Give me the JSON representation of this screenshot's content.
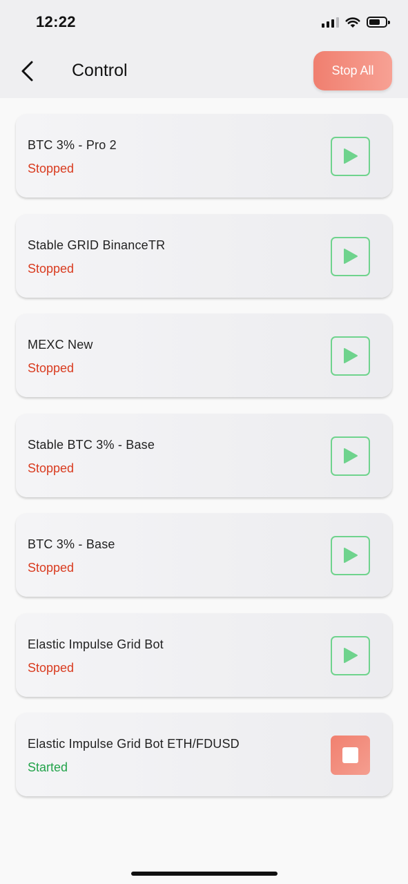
{
  "status_bar": {
    "time": "12:22",
    "icons": [
      "cellular-signal-icon",
      "wifi-icon",
      "battery-icon"
    ]
  },
  "header": {
    "title": "Control",
    "back_icon": "chevron-left-icon",
    "stop_all_label": "Stop All"
  },
  "colors": {
    "stopped": "#d93b1f",
    "started": "#22a34a",
    "start_button": "#6fd38d",
    "stop_button": "#f1806f"
  },
  "bots": [
    {
      "name": "BTC 3% - Pro 2",
      "status": "Stopped",
      "action_icon": "play-icon"
    },
    {
      "name": "Stable GRID BinanceTR",
      "status": "Stopped",
      "action_icon": "play-icon"
    },
    {
      "name": "MEXC New",
      "status": "Stopped",
      "action_icon": "play-icon"
    },
    {
      "name": "Stable BTC 3% - Base",
      "status": "Stopped",
      "action_icon": "play-icon"
    },
    {
      "name": "BTC 3% - Base",
      "status": "Stopped",
      "action_icon": "play-icon"
    },
    {
      "name": "Elastic Impulse Grid Bot",
      "status": "Stopped",
      "action_icon": "play-icon"
    },
    {
      "name": "Elastic Impulse Grid Bot ETH/FDUSD",
      "status": "Started",
      "action_icon": "stop-icon"
    }
  ]
}
